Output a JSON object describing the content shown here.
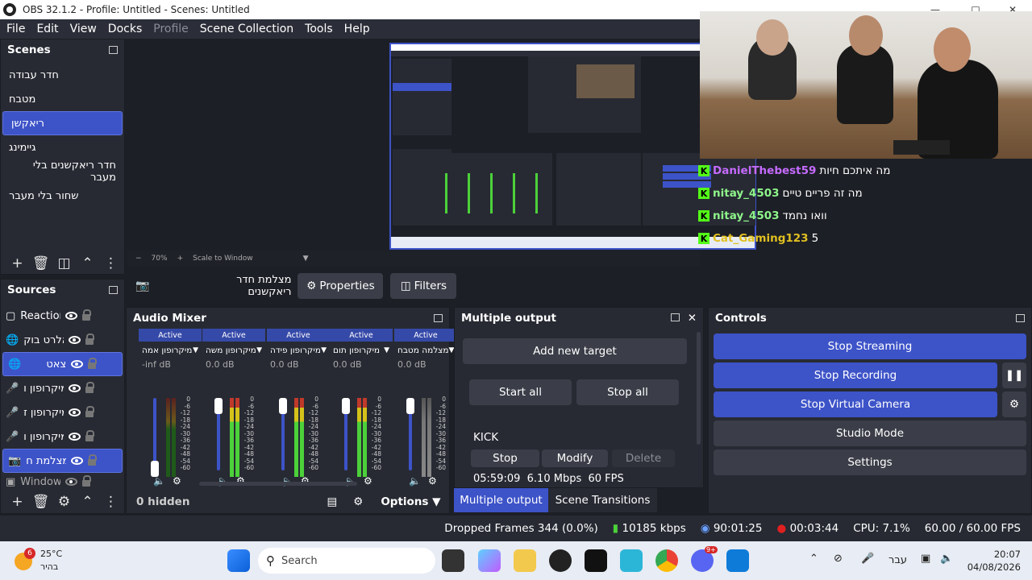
{
  "window": {
    "title": "OBS 32.1.2 - Profile: Untitled - Scenes: Untitled"
  },
  "menu": [
    "File",
    "Edit",
    "View",
    "Docks",
    "Profile",
    "Scene Collection",
    "Tools",
    "Help"
  ],
  "scenes": {
    "title": "Scenes",
    "items": [
      "חדר עבודה",
      "מטבח",
      "ריאקשן",
      "גיימינג",
      "חדר ריאקשנים בלי מעבר",
      "שחור בלי מעבר"
    ],
    "selected_index": 2
  },
  "sources": {
    "title": "Sources",
    "items": [
      {
        "name": "Reaction",
        "icon": "media-icon"
      },
      {
        "name": "אלרט בוק",
        "icon": "browser-icon"
      },
      {
        "name": "צאט",
        "icon": "browser-icon"
      },
      {
        "name": "מיקרופון ו",
        "icon": "mic-icon"
      },
      {
        "name": "מיקרופון ז",
        "icon": "mic-icon"
      },
      {
        "name": "מיקרופון ו",
        "icon": "mic-icon"
      },
      {
        "name": "מצלמת ח",
        "icon": "camera-icon"
      },
      {
        "name": "Window",
        "icon": "window-icon"
      }
    ],
    "selected_indices": [
      2,
      6
    ]
  },
  "preview": {
    "zoom": "70%",
    "scale_mode": "Scale to Window",
    "chat": [
      {
        "user": "DanielThebest59",
        "msg": "מה איתכם חיות",
        "color": "#c56bff"
      },
      {
        "user": "nitay_4503",
        "msg": "מה זה פריים טיים",
        "color": "#8ef58a"
      },
      {
        "user": "nitay_4503",
        "msg": "וואו נחמד",
        "color": "#8ef58a"
      },
      {
        "user": "Cat_Gaming123",
        "msg": "5",
        "color": "#e0c020"
      }
    ]
  },
  "context_bar": {
    "source_name": "מצלמת חדר ריאקשנים",
    "properties": "Properties",
    "filters": "Filters"
  },
  "audio_mixer": {
    "title": "Audio Mixer",
    "channels": [
      {
        "name": "מיקרופון אמה",
        "status": "Active",
        "db": "-inf dB",
        "muted": false,
        "level": 0.0
      },
      {
        "name": "מיקרופון משה",
        "status": "Active",
        "db": "0.0 dB",
        "muted": false,
        "level": 0.85
      },
      {
        "name": "מיקרופון פידה",
        "status": "Active",
        "db": "0.0 dB",
        "muted": false,
        "level": 0.85
      },
      {
        "name": "מיקרופון תום",
        "status": "Active",
        "db": "0.0 dB",
        "muted": false,
        "level": 0.85
      },
      {
        "name": "מצלמה מטבח",
        "status": "Active",
        "db": "0.0 dB",
        "muted": true,
        "level": 0.85
      }
    ],
    "scale": [
      "0",
      "-6",
      "-12",
      "-18",
      "-24",
      "-30",
      "-36",
      "-42",
      "-48",
      "-54",
      "-60"
    ],
    "hidden": "0 hidden",
    "options": "Options"
  },
  "multiple_output": {
    "title": "Multiple output",
    "add_target": "Add new target",
    "start_all": "Start all",
    "stop_all": "Stop all",
    "target_name": "KICK",
    "stop": "Stop",
    "modify": "Modify",
    "delete": "Delete",
    "stats": "05:59:09  6.10 Mbps  60 FPS"
  },
  "bottom_tabs": [
    "Multiple output",
    "Scene Transitions"
  ],
  "controls": {
    "title": "Controls",
    "stop_streaming": "Stop Streaming",
    "stop_recording": "Stop Recording",
    "stop_virtual_camera": "Stop Virtual Camera",
    "studio_mode": "Studio Mode",
    "settings": "Settings"
  },
  "status": {
    "dropped": "Dropped Frames 344 (0.0%)",
    "bitrate": "10185 kbps",
    "stream_time": "90:01:25",
    "rec_time": "00:03:44",
    "cpu": "CPU: 7.1%",
    "fps": "60.00 / 60.00 FPS"
  },
  "taskbar": {
    "weather_temp": "25°C",
    "weather_desc": "בהיר",
    "weather_badge": "6",
    "search": "Search",
    "lang": "עבר",
    "time": "20:07",
    "date": "04/08/2026",
    "discord_badge": "9+"
  },
  "colors": {
    "accent": "#3d53c8",
    "bg": "#1d1f26",
    "panel": "#272a33"
  }
}
